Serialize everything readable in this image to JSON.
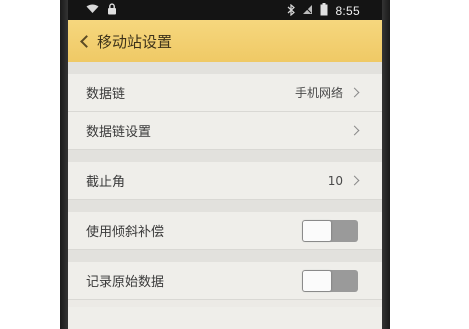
{
  "status_bar": {
    "time": "8:55",
    "left_icons": [
      "wifi-icon",
      "lock-icon"
    ],
    "right_icons": [
      "bluetooth-icon",
      "signal-icon",
      "battery-icon"
    ]
  },
  "header": {
    "title": "移动站设置",
    "accent_color": "#f2cf6f"
  },
  "settings": {
    "data_link": {
      "label": "数据链",
      "value": "手机网络"
    },
    "data_link_settings": {
      "label": "数据链设置"
    },
    "cutoff_angle": {
      "label": "截止角",
      "value": "10"
    },
    "tilt_compensation": {
      "label": "使用倾斜补偿",
      "enabled": false
    },
    "record_raw_data": {
      "label": "记录原始数据",
      "enabled": false
    }
  }
}
